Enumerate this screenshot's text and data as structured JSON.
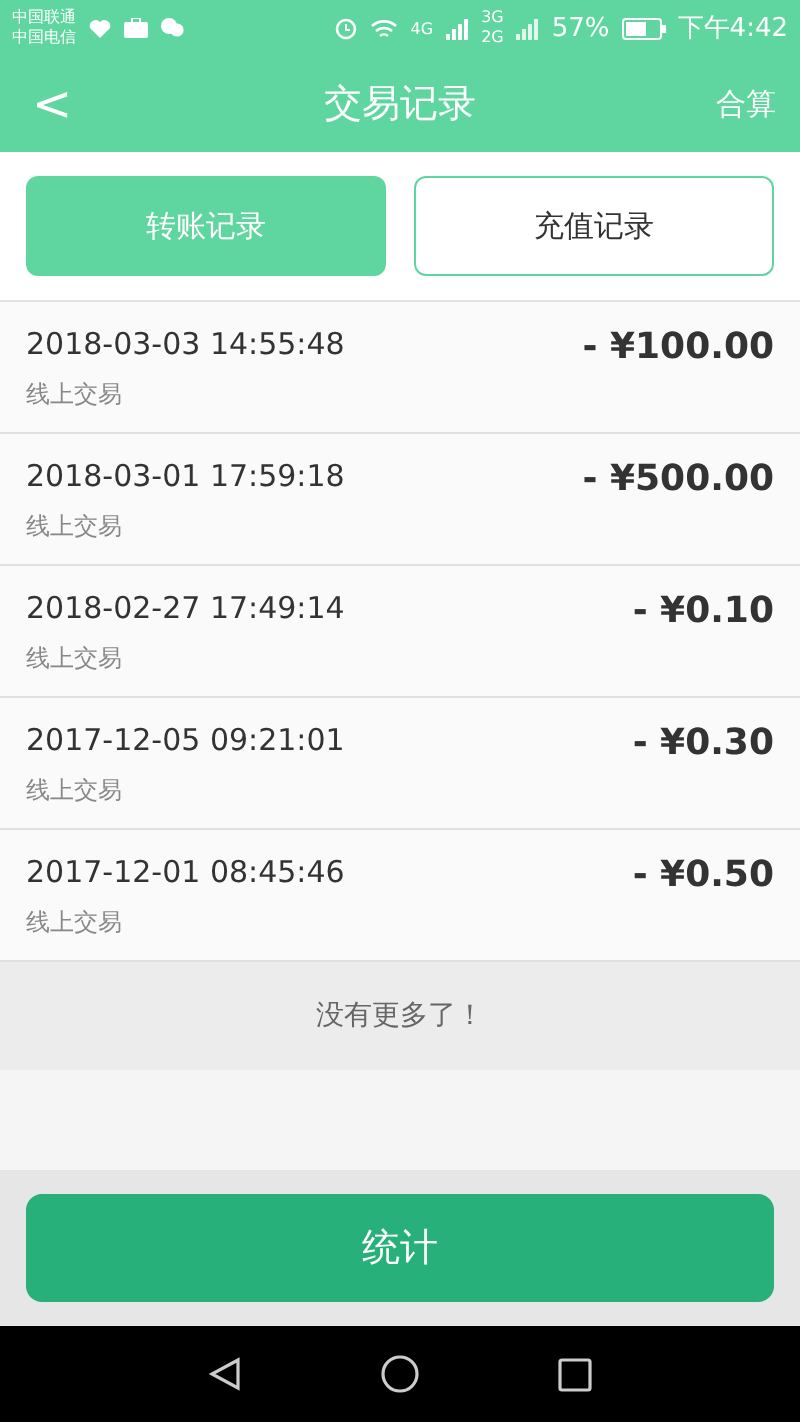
{
  "status_bar": {
    "carriers": [
      "中国联通",
      "中国电信"
    ],
    "network_labels": [
      "4G",
      "3G",
      "2G"
    ],
    "battery": "57%",
    "time": "下午4:42"
  },
  "header": {
    "back": "<",
    "title": "交易记录",
    "action": "合算"
  },
  "tabs": [
    {
      "label": "转账记录",
      "selected": true
    },
    {
      "label": "充值记录",
      "selected": false
    }
  ],
  "records": [
    {
      "time": "2018-03-03 14:55:48",
      "type": "线上交易",
      "amount": "- ¥100.00"
    },
    {
      "time": "2018-03-01 17:59:18",
      "type": "线上交易",
      "amount": "- ¥500.00"
    },
    {
      "time": "2018-02-27 17:49:14",
      "type": "线上交易",
      "amount": "- ¥0.10"
    },
    {
      "time": "2017-12-05 09:21:01",
      "type": "线上交易",
      "amount": "- ¥0.30"
    },
    {
      "time": "2017-12-01 08:45:46",
      "type": "线上交易",
      "amount": "- ¥0.50"
    }
  ],
  "end_note": "没有更多了！",
  "bottom_button": "统计"
}
